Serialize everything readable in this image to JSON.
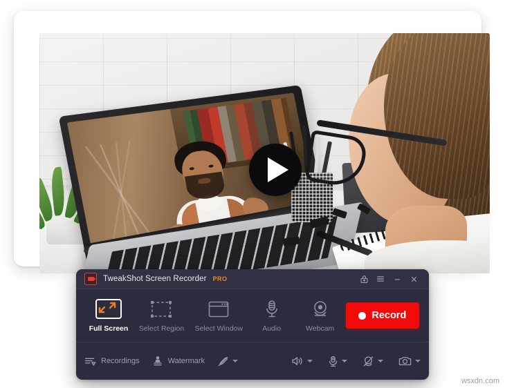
{
  "window": {
    "app_title": "TweakShot Screen Recorder",
    "pro_badge": "PRO",
    "logo_icon": "tweakshot-camera-logo",
    "controls": [
      {
        "name": "screenshot-lock-icon",
        "label": ""
      },
      {
        "name": "menu-hamburger-icon",
        "label": ""
      },
      {
        "name": "minimize-icon",
        "label": ""
      },
      {
        "name": "close-icon",
        "label": ""
      }
    ]
  },
  "modes": [
    {
      "label": "Full Screen",
      "icon": "full-screen-icon",
      "active": true
    },
    {
      "label": "Select Region",
      "icon": "select-region-icon",
      "active": false
    },
    {
      "label": "Select Window",
      "icon": "select-window-icon",
      "active": false
    },
    {
      "label": "Audio",
      "icon": "microphone-icon",
      "active": false
    },
    {
      "label": "Webcam",
      "icon": "webcam-icon",
      "active": false
    }
  ],
  "record": {
    "label": "Record",
    "dot_icon": "record-dot-icon",
    "color": "#f50a0a"
  },
  "bottombar": {
    "recordings_label": "Recordings",
    "recordings_icon": "recordings-list-icon",
    "watermark_label": "Watermark",
    "watermark_icon": "watermark-stamp-icon",
    "tools": [
      {
        "icon": "pen-disabled-icon",
        "caret": "chevron-down-icon"
      },
      {
        "icon": "speaker-icon",
        "caret": "chevron-down-icon"
      },
      {
        "icon": "microphone-icon",
        "caret": "chevron-down-icon"
      },
      {
        "icon": "webcam-off-icon",
        "caret": "chevron-down-icon"
      },
      {
        "icon": "camera-icon",
        "caret": "chevron-down-icon"
      }
    ]
  },
  "hero": {
    "play_icon": "play-button-icon",
    "call_buttons": [
      {
        "name": "video-call-camera-button",
        "color": "#1e90e0"
      },
      {
        "name": "video-call-mic-button",
        "color": "#1e90e0"
      },
      {
        "name": "video-call-speaker-button",
        "color": "#1e90e0"
      },
      {
        "name": "video-call-hangup-button",
        "color": "#e02b2b"
      }
    ]
  },
  "watermark": {
    "text": "wsxdn.com"
  },
  "colors": {
    "panel_bg": "#2b2d3e",
    "titlebar_bg": "#303244",
    "accent_orange": "#f08a22",
    "record_red": "#f50a0a",
    "text_muted": "#8b8fa6",
    "text_bright": "#ffffff"
  }
}
